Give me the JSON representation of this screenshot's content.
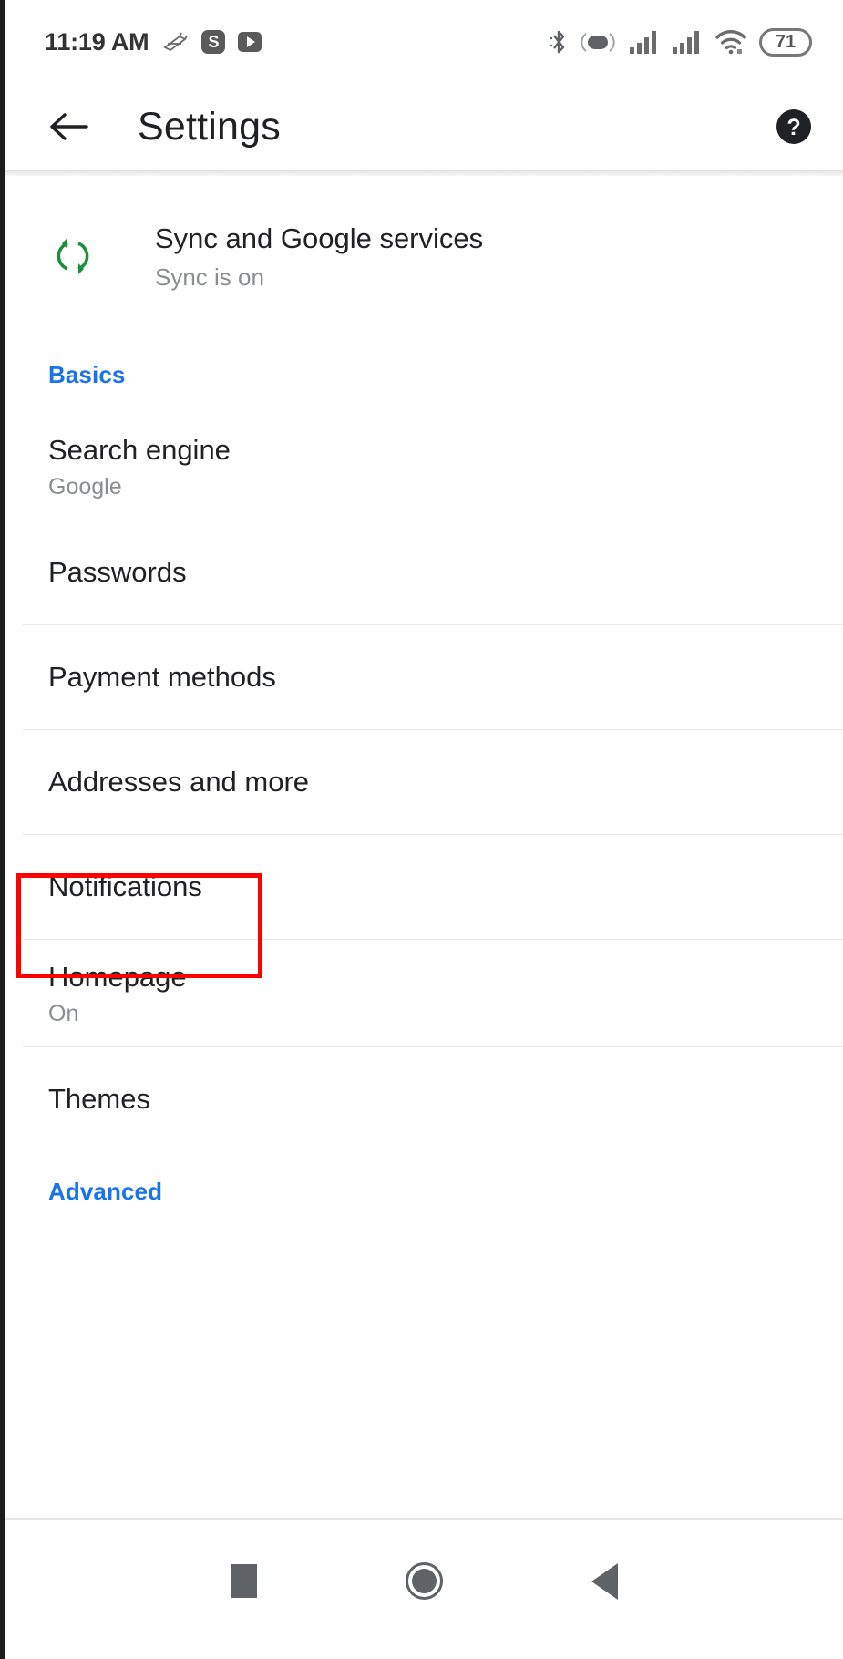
{
  "status_bar": {
    "clock": "11:19 AM",
    "left_icons": [
      {
        "name": "screenshot-icon",
        "label": ""
      },
      {
        "name": "skype-icon",
        "label": "S"
      },
      {
        "name": "youtube-icon",
        "label": ""
      }
    ],
    "right_icons": [
      {
        "name": "bluetooth-icon"
      },
      {
        "name": "vibrate-icon"
      },
      {
        "name": "signal-sim1-icon"
      },
      {
        "name": "signal-sim2-icon"
      },
      {
        "name": "wifi-icon"
      }
    ],
    "battery_level": "71"
  },
  "app_bar": {
    "back_label": "Back",
    "title": "Settings",
    "help_label": "Help & feedback"
  },
  "sync": {
    "icon": "sync-icon",
    "title": "Sync and Google services",
    "subtitle": "Sync is on",
    "icon_color": "#1e8e3e"
  },
  "sections": [
    {
      "header": "Basics",
      "header_color": "#1a73e8",
      "items": [
        {
          "name": "search-engine",
          "title": "Search engine",
          "subtitle": "Google",
          "divider": true,
          "highlighted": false
        },
        {
          "name": "passwords",
          "title": "Passwords",
          "subtitle": "",
          "divider": true,
          "highlighted": false
        },
        {
          "name": "payment-methods",
          "title": "Payment methods",
          "subtitle": "",
          "divider": true,
          "highlighted": false
        },
        {
          "name": "addresses-and-more",
          "title": "Addresses and more",
          "subtitle": "",
          "divider": true,
          "highlighted": false
        },
        {
          "name": "notifications",
          "title": "Notifications",
          "subtitle": "",
          "divider": true,
          "highlighted": true
        },
        {
          "name": "homepage",
          "title": "Homepage",
          "subtitle": "On",
          "divider": true,
          "highlighted": false
        },
        {
          "name": "themes",
          "title": "Themes",
          "subtitle": "",
          "divider": false,
          "highlighted": false
        }
      ]
    },
    {
      "header": "Advanced",
      "header_color": "#1a73e8",
      "items": []
    }
  ],
  "annotation": {
    "target": "Notifications",
    "color": "#ff0000"
  },
  "nav_bar": {
    "recents_label": "Recents",
    "home_label": "Home",
    "back_label": "Back"
  }
}
